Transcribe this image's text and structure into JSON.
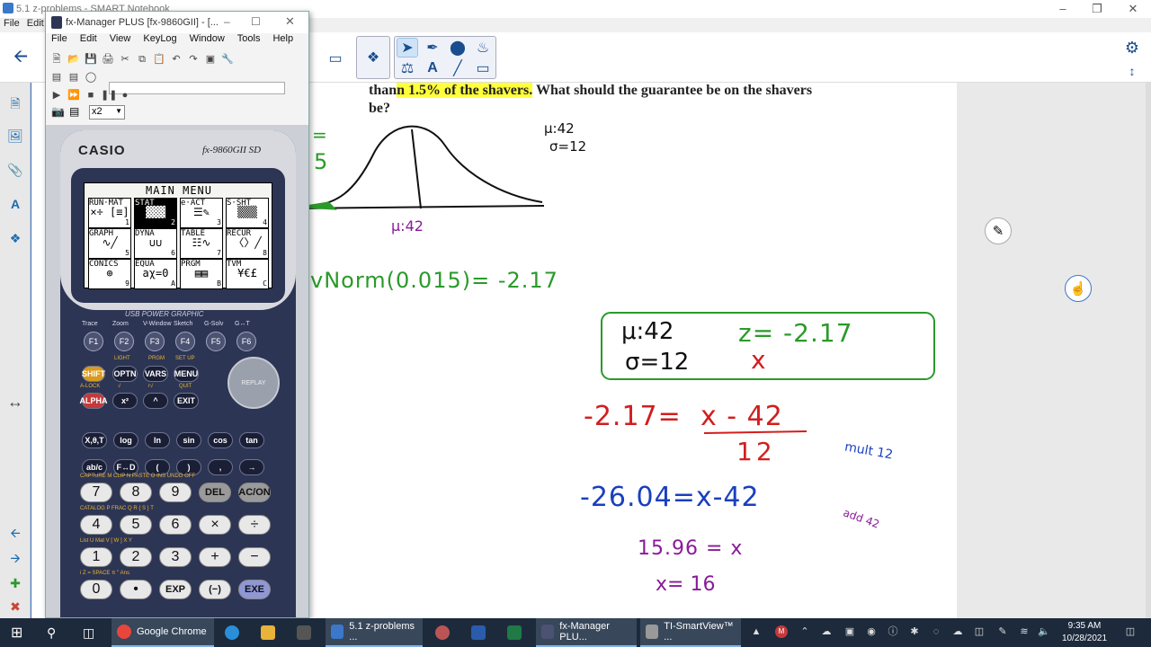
{
  "main_window": {
    "title": "5.1 z-problems - SMART Notebook",
    "menu": [
      "File",
      "Edit"
    ]
  },
  "fx_window": {
    "title": "fx-Manager PLUS [fx-9860GII] - [...",
    "menu": [
      "File",
      "Edit",
      "View",
      "KeyLog",
      "Window",
      "Tools",
      "Help"
    ],
    "select_value": "x2"
  },
  "calculator": {
    "brand": "CASIO",
    "model": "fx-9860GII SD",
    "usb_label": "USB POWER GRAPHIC",
    "screen_title": "MAIN MENU",
    "menu_items": [
      {
        "label": "RUN·MAT",
        "num": "1",
        "glyph": "×÷ [≡]"
      },
      {
        "label": "STAT",
        "num": "2",
        "glyph": "▓▓▓"
      },
      {
        "label": "e·ACT",
        "num": "3",
        "glyph": "☰✎"
      },
      {
        "label": "S·SHT",
        "num": "4",
        "glyph": "▒▒▒"
      },
      {
        "label": "GRAPH",
        "num": "5",
        "glyph": "∿╱"
      },
      {
        "label": "DYNA",
        "num": "6",
        "glyph": "∪∪"
      },
      {
        "label": "TABLE",
        "num": "7",
        "glyph": "☷∿"
      },
      {
        "label": "RECUR",
        "num": "8",
        "glyph": "〈〉╱"
      },
      {
        "label": "CONICS",
        "num": "9",
        "glyph": "⊕"
      },
      {
        "label": "EQUA",
        "num": "A",
        "glyph": "aχ=0"
      },
      {
        "label": "PRGM",
        "num": "B",
        "glyph": "▤▤"
      },
      {
        "label": "TVM",
        "num": "C",
        "glyph": "¥€£"
      }
    ],
    "fn_labels": [
      "Trace",
      "Zoom",
      "V-Window",
      "Sketch",
      "G-Solv",
      "G↔T"
    ],
    "fkeys": [
      "F1",
      "F2",
      "F3",
      "F4",
      "F5",
      "F6"
    ],
    "row1": [
      "SHIFT",
      "OPTN",
      "VARS",
      "MENU"
    ],
    "row1_top": [
      "LIGHT",
      "PRGM",
      "SET UP"
    ],
    "row2": [
      "ALPHA",
      "x²",
      "^",
      "EXIT"
    ],
    "row2_top": [
      "A-LOCK",
      "√",
      "r√",
      "QUIT"
    ],
    "replay": "REPLAY",
    "row3": [
      "X,θ,T",
      "log",
      "ln",
      "sin",
      "cos",
      "tan"
    ],
    "row4": [
      "ab/c",
      "F↔D",
      "(",
      ")",
      ",",
      "→"
    ],
    "num_rows": [
      [
        "7",
        "8",
        "9",
        "DEL",
        "AC/ON"
      ],
      [
        "4",
        "5",
        "6",
        "×",
        "÷"
      ],
      [
        "1",
        "2",
        "3",
        "+",
        "−"
      ],
      [
        "0",
        "•",
        "EXP",
        "(−)",
        "EXE"
      ]
    ],
    "num_tops": [
      "CAPTURE  M   CLIP  N   PASTE  O   INS  UNDO   OFF",
      "CATALOG  P   FRAC  Q   R   {  S   }  T",
      "List  U   Mat  V   [  W   ]  X   Y",
      "i   Z   =   SPACE   π   \"   Ans"
    ]
  },
  "problem_text": {
    "prefix": "than",
    "highlight": "n 1.5% of the shavers.",
    "suffix": " What should the guarantee be on the shavers",
    "line2": "be?"
  },
  "handwriting": {
    "eq_fragment": "=",
    "five": "5",
    "mu_label_top": "μ:42",
    "sigma_label_top": "σ=12",
    "mu_axis": "μ:42",
    "invnorm": "vNorm(0.015)= -2.17",
    "box_mu": "μ:42",
    "box_sigma": "σ=12",
    "box_z": "z= -2.17",
    "box_x": "x",
    "eq1_left": "-2.17=",
    "eq1_num": "x - 42",
    "eq1_den": "12",
    "mult": "mult 12",
    "eq2": "-26.04=x-42",
    "add": "add 42",
    "eq3": "15.96 = x",
    "eq4": "x= 16"
  },
  "taskbar": {
    "items": [
      {
        "label": "Google Chrome"
      },
      {
        "label": "5.1 z-problems ..."
      },
      {
        "label": "fx-Manager PLU..."
      },
      {
        "label": "TI-SmartView™ ..."
      }
    ],
    "time": "9:35 AM",
    "date": "10/28/2021"
  },
  "colors": {
    "accent": "#3a78c9",
    "highlight": "#ffff3c",
    "green_ink": "#2a9a2a",
    "red_ink": "#d21e1e",
    "blue_ink": "#1a3fbf",
    "purple_ink": "#8a1a9a"
  }
}
